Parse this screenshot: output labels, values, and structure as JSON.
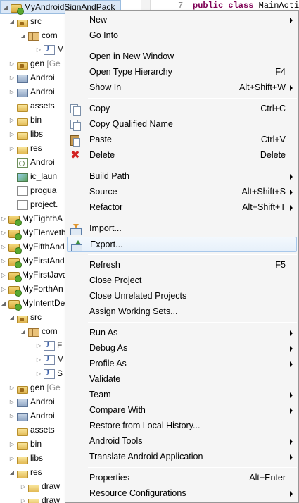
{
  "editor": {
    "line_number": "7",
    "code_keyword": "public class",
    "code_text": " MainActiv"
  },
  "tree": {
    "rows": [
      {
        "label": "MyAndroidSignAndPack",
        "suffix": ""
      },
      {
        "label": "src",
        "suffix": ""
      },
      {
        "label": "com",
        "suffix": ""
      },
      {
        "label": "M",
        "suffix": ""
      },
      {
        "label": "gen",
        "suffix": "[Ge"
      },
      {
        "label": "Androi",
        "suffix": ""
      },
      {
        "label": "Androi",
        "suffix": ""
      },
      {
        "label": "assets",
        "suffix": ""
      },
      {
        "label": "bin",
        "suffix": ""
      },
      {
        "label": "libs",
        "suffix": ""
      },
      {
        "label": "res",
        "suffix": ""
      },
      {
        "label": "Androi",
        "suffix": ""
      },
      {
        "label": "ic_laun",
        "suffix": ""
      },
      {
        "label": "progua",
        "suffix": ""
      },
      {
        "label": "project.",
        "suffix": ""
      },
      {
        "label": "MyEighthA",
        "suffix": ""
      },
      {
        "label": "MyElenveth",
        "suffix": ""
      },
      {
        "label": "MyFifthAnd",
        "suffix": ""
      },
      {
        "label": "MyFirstAnd",
        "suffix": ""
      },
      {
        "label": "MyFirstJava",
        "suffix": ""
      },
      {
        "label": "MyForthAn",
        "suffix": ""
      },
      {
        "label": "MyIntentDe",
        "suffix": ""
      },
      {
        "label": "src",
        "suffix": ""
      },
      {
        "label": "com",
        "suffix": ""
      },
      {
        "label": "F",
        "suffix": ""
      },
      {
        "label": "M",
        "suffix": ""
      },
      {
        "label": "S",
        "suffix": ""
      },
      {
        "label": "gen",
        "suffix": "[Ge"
      },
      {
        "label": "Androi",
        "suffix": ""
      },
      {
        "label": "Androi",
        "suffix": ""
      },
      {
        "label": "assets",
        "suffix": ""
      },
      {
        "label": "bin",
        "suffix": ""
      },
      {
        "label": "libs",
        "suffix": ""
      },
      {
        "label": "res",
        "suffix": ""
      },
      {
        "label": "draw",
        "suffix": ""
      },
      {
        "label": "draw",
        "suffix": ""
      }
    ]
  },
  "menu": {
    "items": [
      {
        "label": "New",
        "shortcut": ""
      },
      {
        "label": "Go Into",
        "shortcut": ""
      },
      {
        "label": "Open in New Window",
        "shortcut": ""
      },
      {
        "label": "Open Type Hierarchy",
        "shortcut": "F4"
      },
      {
        "label": "Show In",
        "shortcut": "Alt+Shift+W"
      },
      {
        "label": "Copy",
        "shortcut": "Ctrl+C"
      },
      {
        "label": "Copy Qualified Name",
        "shortcut": ""
      },
      {
        "label": "Paste",
        "shortcut": "Ctrl+V"
      },
      {
        "label": "Delete",
        "shortcut": "Delete"
      },
      {
        "label": "Build Path",
        "shortcut": ""
      },
      {
        "label": "Source",
        "shortcut": "Alt+Shift+S"
      },
      {
        "label": "Refactor",
        "shortcut": "Alt+Shift+T"
      },
      {
        "label": "Import...",
        "shortcut": ""
      },
      {
        "label": "Export...",
        "shortcut": ""
      },
      {
        "label": "Refresh",
        "shortcut": "F5"
      },
      {
        "label": "Close Project",
        "shortcut": ""
      },
      {
        "label": "Close Unrelated Projects",
        "shortcut": ""
      },
      {
        "label": "Assign Working Sets...",
        "shortcut": ""
      },
      {
        "label": "Run As",
        "shortcut": ""
      },
      {
        "label": "Debug As",
        "shortcut": ""
      },
      {
        "label": "Profile As",
        "shortcut": ""
      },
      {
        "label": "Validate",
        "shortcut": ""
      },
      {
        "label": "Team",
        "shortcut": ""
      },
      {
        "label": "Compare With",
        "shortcut": ""
      },
      {
        "label": "Restore from Local History...",
        "shortcut": ""
      },
      {
        "label": "Android Tools",
        "shortcut": ""
      },
      {
        "label": "Translate Android Application",
        "shortcut": ""
      },
      {
        "label": "Properties",
        "shortcut": "Alt+Enter"
      },
      {
        "label": "Resource Configurations",
        "shortcut": ""
      }
    ]
  },
  "colors": {
    "selection": "#dbe8f7",
    "menu_background": "#f5f5f5",
    "hover_border": "#a8c8eb",
    "delete_icon": "#d22323"
  }
}
